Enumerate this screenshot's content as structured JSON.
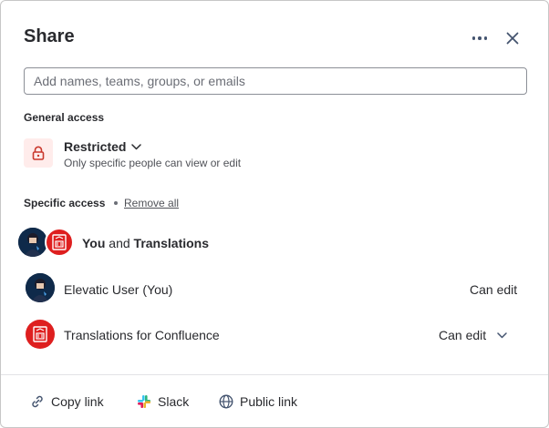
{
  "dialog": {
    "title": "Share",
    "more_icon": "more-horizontal-icon",
    "close_icon": "close-icon"
  },
  "search": {
    "placeholder": "Add names, teams, groups, or emails",
    "value": ""
  },
  "general_access": {
    "label": "General access",
    "icon": "lock-icon",
    "selected": "Restricted",
    "description": "Only specific people can view or edit"
  },
  "specific_access": {
    "label": "Specific access",
    "remove_all": "Remove all",
    "summary": {
      "first": "You",
      "joiner": "and",
      "second": "Translations"
    },
    "members": [
      {
        "name": "Elevatic User (You)",
        "permission": "Can edit",
        "avatar": "user-avatar"
      },
      {
        "name": "Translations for Confluence",
        "permission": "Can edit",
        "avatar": "translations-app-icon"
      }
    ]
  },
  "footer": {
    "copy_link": "Copy link",
    "slack": "Slack",
    "public_link": "Public link"
  },
  "colors": {
    "accent_red": "#de1f1f",
    "lock_bg": "#ffeceb",
    "text": "#292a2e",
    "subtle_text": "#505258",
    "avatar_bg": "#0f2a4a"
  }
}
